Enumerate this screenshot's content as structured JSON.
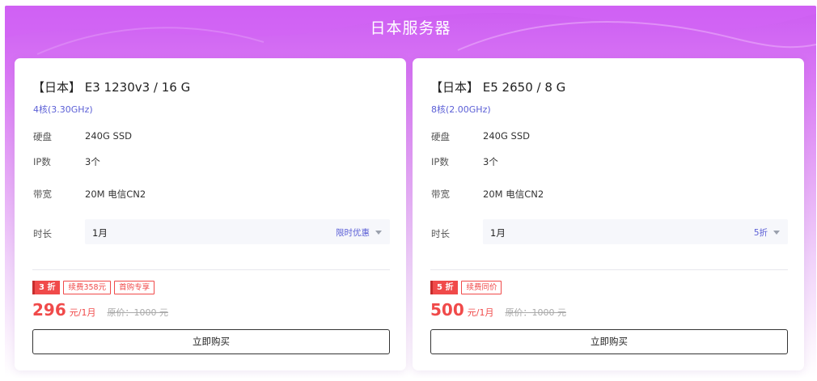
{
  "page": {
    "title": "日本服务器"
  },
  "colors": {
    "accent": "#5b5fd6",
    "price_red": "#f04a4a",
    "header_purple": "#cc5cf2"
  },
  "cards": [
    {
      "title": "【日本】 E3 1230v3 / 16 G",
      "cpu": "4核(3.30GHz)",
      "specs": [
        {
          "label": "硬盘",
          "value": "240G SSD"
        },
        {
          "label": "IP数",
          "value": "3个"
        },
        {
          "label": "带宽",
          "value": "20M 电信CN2"
        }
      ],
      "duration": {
        "label": "时长",
        "selected": "1月",
        "promo": "限时优惠"
      },
      "discount_badge": "3 折",
      "tags": [
        "续费358元",
        "首购专享"
      ],
      "price": "296",
      "unit": "元/1月",
      "original_price": "原价：1000 元",
      "buy_label": "立即购买"
    },
    {
      "title": "【日本】 E5 2650 / 8 G",
      "cpu": "8核(2.00GHz)",
      "specs": [
        {
          "label": "硬盘",
          "value": "240G SSD"
        },
        {
          "label": "IP数",
          "value": "3个"
        },
        {
          "label": "带宽",
          "value": "20M 电信CN2"
        }
      ],
      "duration": {
        "label": "时长",
        "selected": "1月",
        "promo": "5折"
      },
      "discount_badge": "5 折",
      "tags": [
        "续费同价"
      ],
      "price": "500",
      "unit": "元/1月",
      "original_price": "原价：1000 元",
      "buy_label": "立即购买"
    }
  ]
}
